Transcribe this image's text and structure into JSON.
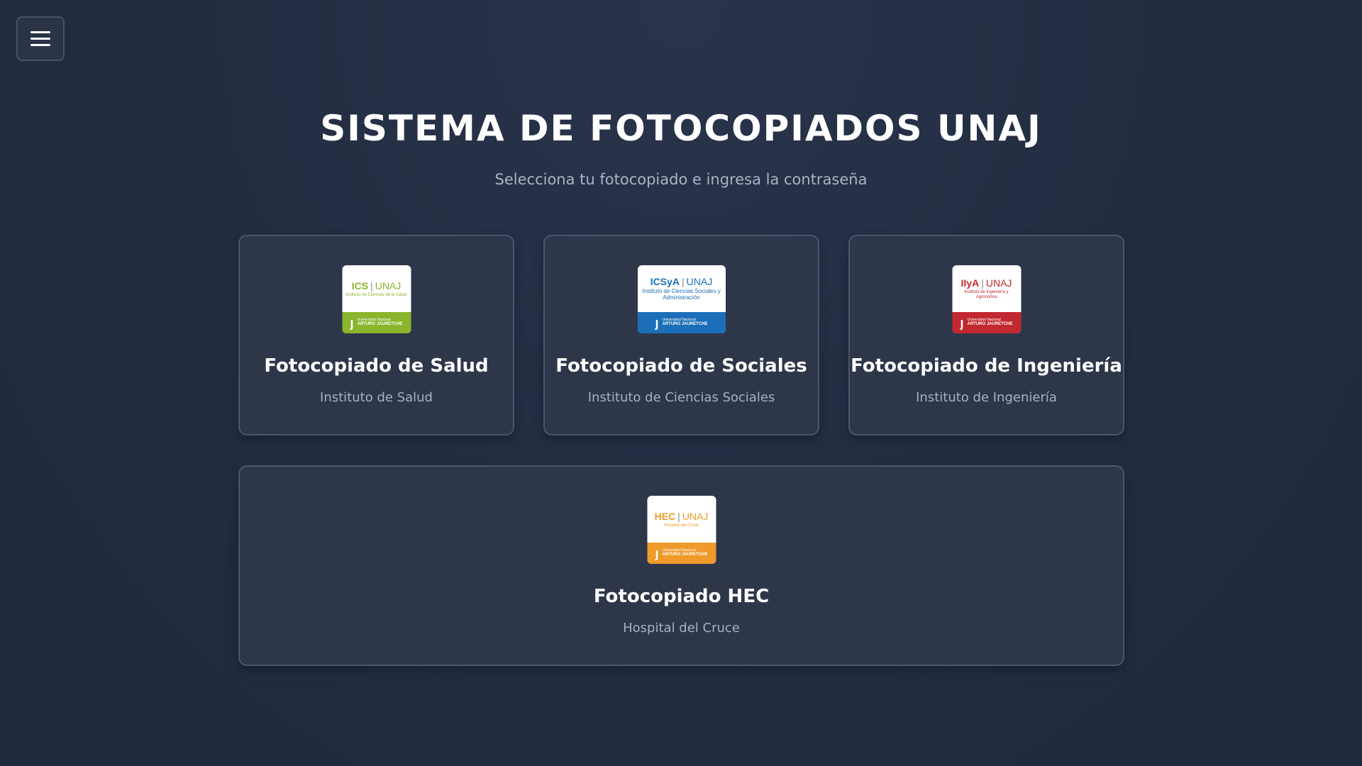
{
  "menu": {
    "icon": "hamburger-icon"
  },
  "header": {
    "title": "SISTEMA DE FOTOCOPIADOS UNAJ",
    "subtitle": "Selecciona tu fotocopiado e ingresa la contraseña"
  },
  "cards": [
    {
      "title": "Fotocopiado de Salud",
      "subtitle": "Instituto de Salud",
      "logo": {
        "acronym": "ICS",
        "unaj": "UNAJ",
        "tagline": "Instituto de Ciencias de la Salud",
        "uni_line1": "Universidad Nacional",
        "uni_line2": "ARTURO JAURETCHE",
        "color": "#8ab52c"
      }
    },
    {
      "title": "Fotocopiado de Sociales",
      "subtitle": "Instituto de Ciencias Sociales",
      "logo": {
        "acronym": "ICSyA",
        "unaj": "UNAJ",
        "tagline": "Instituto de Ciencias Sociales y Administración",
        "uni_line1": "Universidad Nacional",
        "uni_line2": "ARTURO JAURETCHE",
        "color": "#1a6fb8"
      }
    },
    {
      "title": "Fotocopiado de Ingeniería",
      "subtitle": "Instituto de Ingeniería",
      "logo": {
        "acronym": "IIyA",
        "unaj": "UNAJ",
        "tagline": "Instituto de Ingeniería y Agronomía",
        "uni_line1": "Universidad Nacional",
        "uni_line2": "ARTURO JAURETCHE",
        "color": "#c1282f"
      }
    },
    {
      "title": "Fotocopiado HEC",
      "subtitle": "Hospital del Cruce",
      "logo": {
        "acronym": "HEC",
        "unaj": "UNAJ",
        "tagline": "Hospital del Cruce",
        "uni_line1": "Universidad Nacional",
        "uni_line2": "ARTURO JAURETCHE",
        "color": "#ef9a2a"
      }
    }
  ]
}
